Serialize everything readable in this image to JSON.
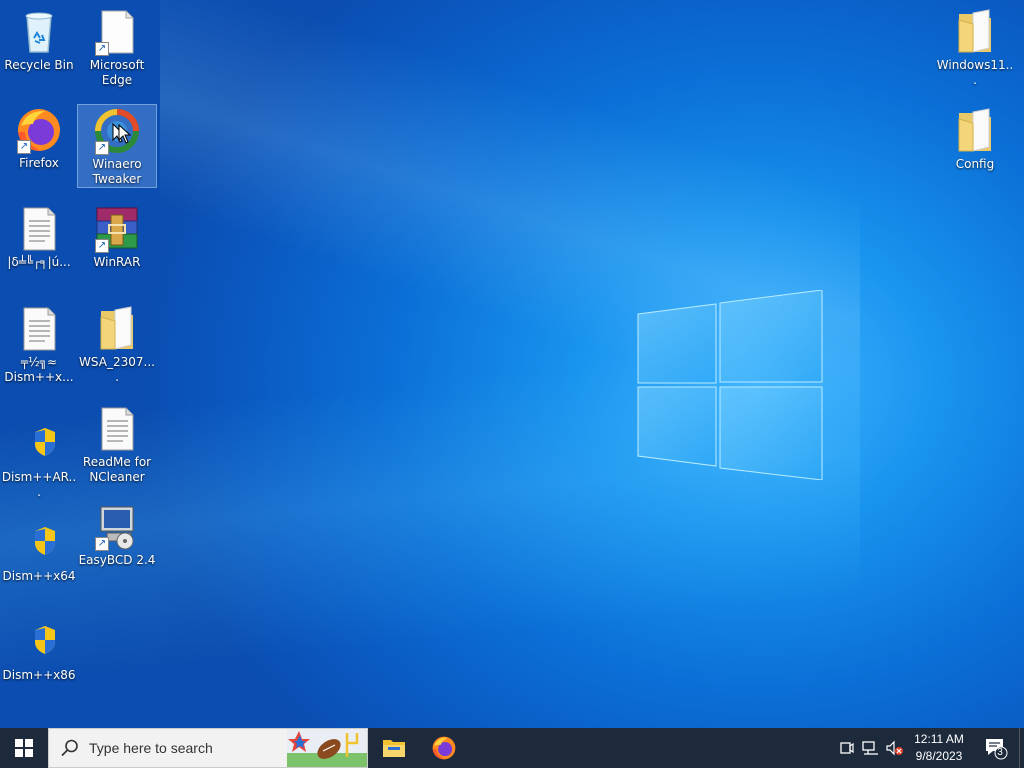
{
  "desktop": {
    "icons": [
      {
        "label": "Recycle Bin",
        "icon": "recycle-bin-icon"
      },
      {
        "label": "Microsoft Edge",
        "icon": "edge-file-icon"
      },
      {
        "label": "Firefox",
        "icon": "firefox-icon"
      },
      {
        "label": "Winaero Tweaker",
        "icon": "winaero-tweaker-icon"
      },
      {
        "label": "|δ╧╚┌╕|ú...",
        "icon": "text-file-icon"
      },
      {
        "label": "WinRAR",
        "icon": "winrar-icon"
      },
      {
        "label": "╤½╗≈ Dism++x...",
        "icon": "text-file-icon"
      },
      {
        "label": "WSA_2307....",
        "icon": "folder-icon"
      },
      {
        "label": "Dism++AR...",
        "icon": "uac-shield-icon"
      },
      {
        "label": "ReadMe for NCleaner",
        "icon": "text-file-icon"
      },
      {
        "label": "Dism++x64",
        "icon": "uac-shield-icon"
      },
      {
        "label": "EasyBCD 2.4",
        "icon": "easybcd-icon"
      },
      {
        "label": "Dism++x86",
        "icon": "uac-shield-icon"
      },
      {
        "label": "Windows11...",
        "icon": "folder-icon"
      },
      {
        "label": "Config",
        "icon": "folder-icon"
      }
    ]
  },
  "taskbar": {
    "search_placeholder": "Type here to search",
    "time": "12:11 AM",
    "date": "9/8/2023",
    "notification_count": "3",
    "pinned": [
      "file-explorer-icon",
      "firefox-icon"
    ]
  },
  "colors": {
    "taskbar": "#1c2a3c",
    "desktop_blue": "#0b6fd6"
  }
}
